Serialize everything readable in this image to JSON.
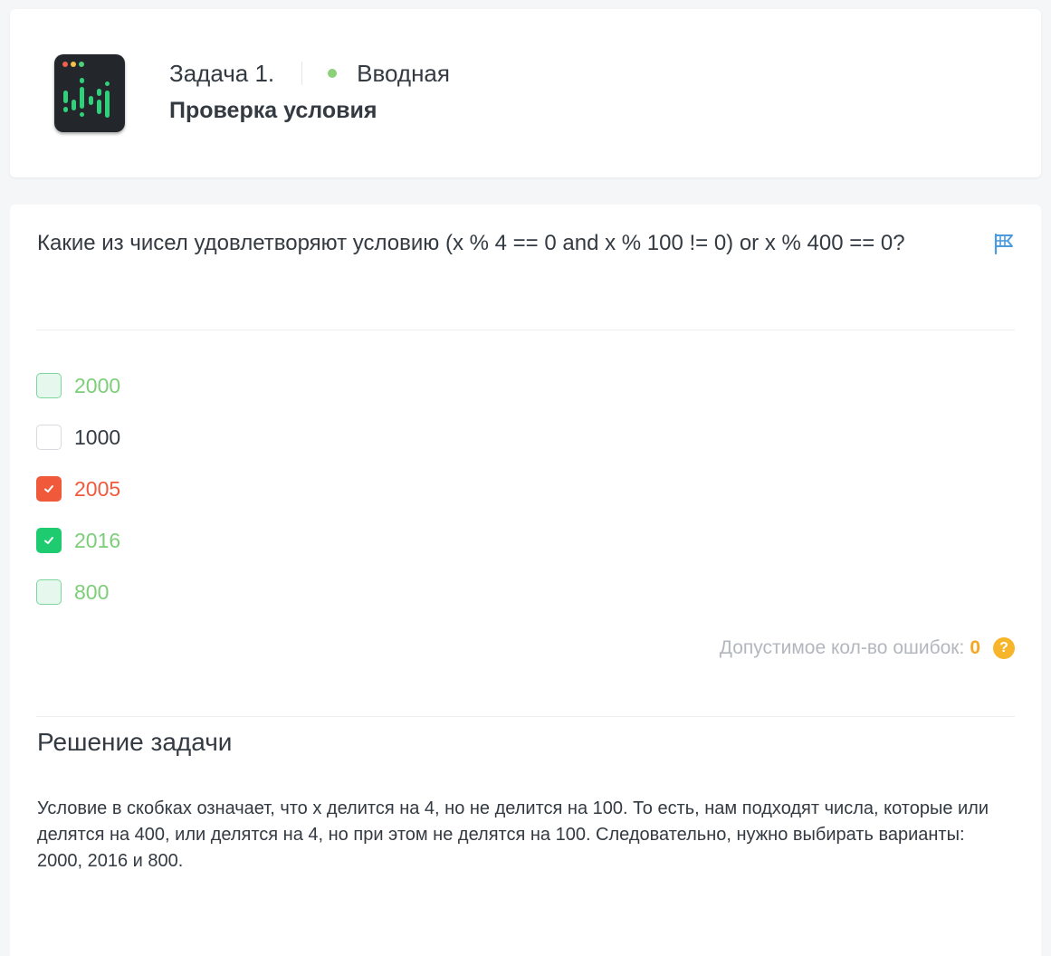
{
  "header": {
    "task_number": "Задача 1.",
    "level": "Вводная",
    "title": "Проверка условия"
  },
  "question": {
    "text": "Какие из чисел удовлетворяют условию (x % 4 == 0 and x % 100 != 0) or x % 400 == 0?"
  },
  "options": [
    {
      "label": "2000",
      "checked": false,
      "state": "correct-unselected"
    },
    {
      "label": "1000",
      "checked": false,
      "state": "neutral"
    },
    {
      "label": "2005",
      "checked": true,
      "state": "wrong"
    },
    {
      "label": "2016",
      "checked": true,
      "state": "correct"
    },
    {
      "label": "800",
      "checked": false,
      "state": "correct-unselected"
    }
  ],
  "errors": {
    "label": "Допустимое кол-во ошибок:",
    "count": "0",
    "help_icon": "?"
  },
  "solution": {
    "title": "Решение задачи",
    "text": "Условие в скобках означает, что x делится на 4, но не делится на 100. То есть, нам подходят числа, которые или делятся на 400, или делятся на 4, но при этом не делятся на 100. Следовательно, нужно выбирать варианты: 2000, 2016 и 800."
  },
  "colors": {
    "correct": "#7ccf78",
    "wrong": "#ef5a3c",
    "checked_ok": "#1ecb6e",
    "accent_orange": "#f5a623",
    "flag_blue": "#4a9be0"
  }
}
